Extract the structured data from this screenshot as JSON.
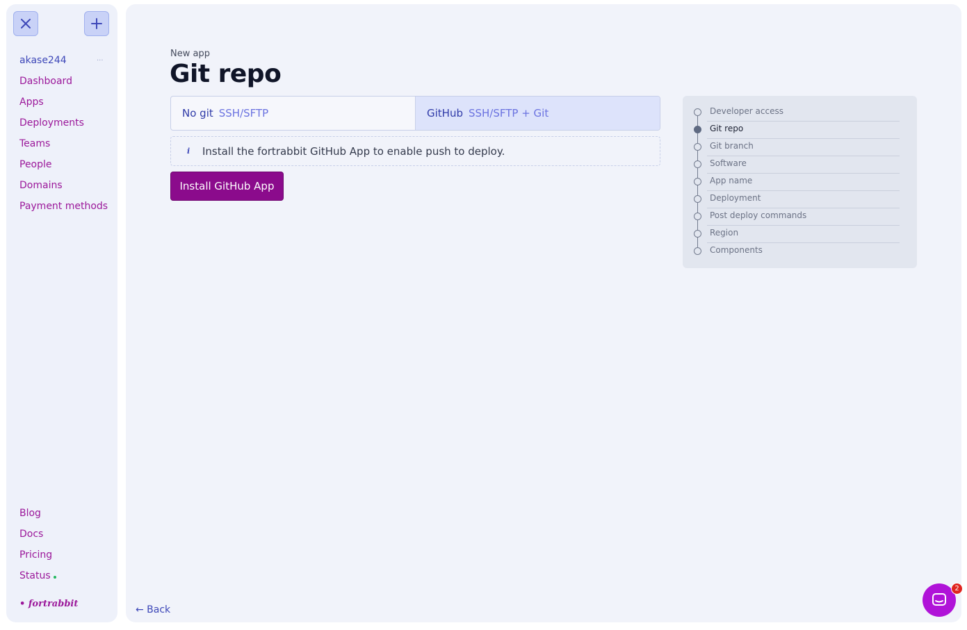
{
  "sidebar": {
    "username": "akase244",
    "user_more": "···",
    "nav": [
      "Dashboard",
      "Apps",
      "Deployments",
      "Teams",
      "People",
      "Domains",
      "Payment methods"
    ],
    "footer_nav": [
      "Blog",
      "Docs",
      "Pricing",
      "Status"
    ],
    "brand": "• fortrabbit",
    "icons": {
      "close": "close-icon",
      "add": "plus-icon"
    }
  },
  "main": {
    "kicker": "New app",
    "title": "Git repo",
    "tabs": [
      {
        "label": "No git",
        "sub": "SSH/SFTP",
        "active": false
      },
      {
        "label": "GitHub",
        "sub": "SSH/SFTP + Git",
        "active": true
      }
    ],
    "notice_icon": "i",
    "notice": "Install the fortrabbit GitHub App to enable push to deploy.",
    "install_button": "Install GitHub App",
    "back": "← Back"
  },
  "steps": {
    "items": [
      "Developer access",
      "Git repo",
      "Git branch",
      "Software",
      "App name",
      "Deployment",
      "Post deploy commands",
      "Region",
      "Components"
    ],
    "current": 1
  },
  "chat": {
    "badge": "2",
    "icon": "chat-icon"
  },
  "colors": {
    "accent": "#9b179a",
    "primary_button": "#8b0b8c",
    "link": "#3d47b8",
    "status_ok": "#24b85f",
    "chat": "#b013d8"
  }
}
